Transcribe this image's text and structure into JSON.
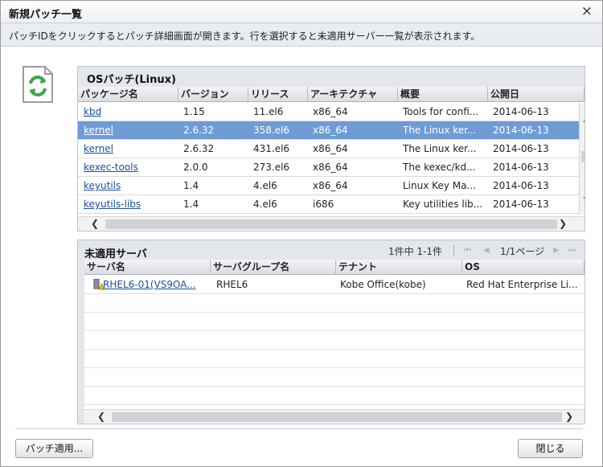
{
  "dialog": {
    "title": "新規パッチ一覧",
    "close": "×",
    "info": "パッチIDをクリックするとパッチ詳細画面が開きます。行を選択すると未適用サーバー一覧が表示されます。"
  },
  "os_patch": {
    "title": "OSパッチ(Linux)",
    "columns": [
      "パッケージ名",
      "バージョン",
      "リリース",
      "アーキテクチャ",
      "概要",
      "公開日"
    ],
    "rows": [
      {
        "name": "kbd",
        "version": "1.15",
        "release": "11.el6",
        "arch": "x86_64",
        "summary": "Tools for confi...",
        "date": "2014-06-13",
        "selected": false
      },
      {
        "name": "kernel",
        "version": "2.6.32",
        "release": "358.el6",
        "arch": "x86_64",
        "summary": "The Linux ker...",
        "date": "2014-06-13",
        "selected": true
      },
      {
        "name": "kernel",
        "version": "2.6.32",
        "release": "431.el6",
        "arch": "x86_64",
        "summary": "The Linux ker...",
        "date": "2014-06-13",
        "selected": false
      },
      {
        "name": "kexec-tools",
        "version": "2.0.0",
        "release": "273.el6",
        "arch": "x86_64",
        "summary": "The kexec/kd...",
        "date": "2014-06-13",
        "selected": false
      },
      {
        "name": "keyutils",
        "version": "1.4",
        "release": "4.el6",
        "arch": "x86_64",
        "summary": "Linux Key Ma...",
        "date": "2014-06-13",
        "selected": false
      },
      {
        "name": "keyutils-libs",
        "version": "1.4",
        "release": "4.el6",
        "arch": "i686",
        "summary": "Key utilities lib...",
        "date": "2014-06-13",
        "selected": false
      }
    ]
  },
  "servers": {
    "title": "未適用サーバ",
    "count": "1件中 1-1件",
    "page": "1/1ページ",
    "columns": [
      "サーバ名",
      "サーバグループ名",
      "テナント",
      "OS"
    ],
    "rows": [
      {
        "name": "RHEL6-01(VS9OA...",
        "group": "RHEL6",
        "tenant": "Kobe Office(kobe)",
        "os": "Red Hat Enterprise Li..."
      }
    ]
  },
  "buttons": {
    "apply": "パッチ適用...",
    "close": "閉じる"
  },
  "colors": {
    "selected_row": "#6f9bd6",
    "link": "#1a4fa3",
    "icon_green": "#3fa64a"
  }
}
